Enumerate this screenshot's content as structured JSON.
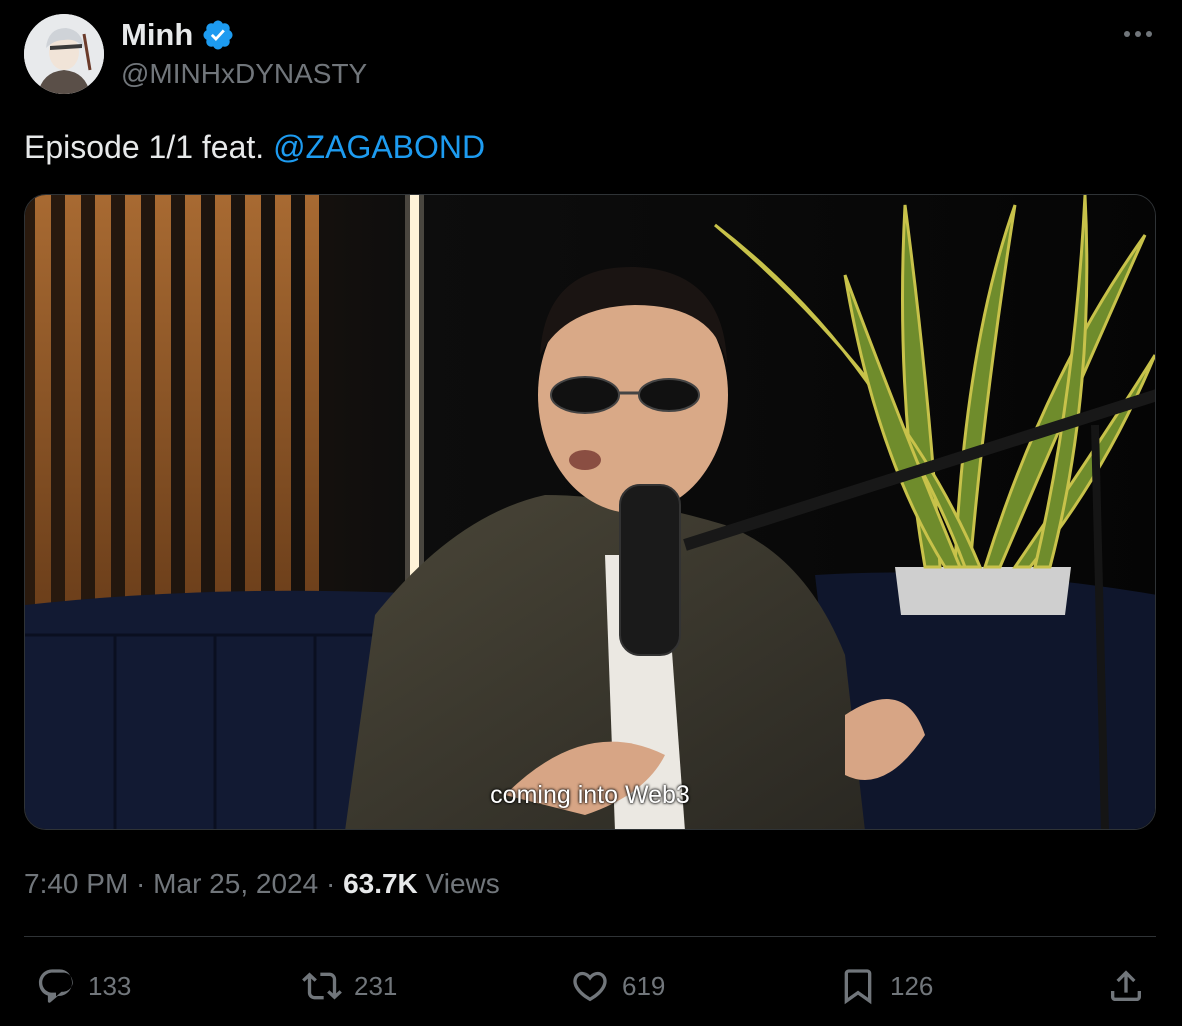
{
  "author": {
    "display_name": "Minh",
    "handle": "@MINHxDYNASTY",
    "verified": true,
    "verified_color": "#1d9bf0"
  },
  "tweet": {
    "text_prefix": "Episode 1/1 feat. ",
    "mention": "@ZAGABOND",
    "mention_color": "#1d9bf0"
  },
  "media": {
    "caption": "coming into Web3"
  },
  "meta": {
    "time": "7:40 PM",
    "separator1": " · ",
    "date": "Mar 25, 2024",
    "separator2": " · ",
    "views_count": "63.7K",
    "views_label": " Views"
  },
  "actions": {
    "replies": "133",
    "retweets": "231",
    "likes": "619",
    "bookmarks": "126"
  },
  "icons": {
    "more": "more-icon",
    "reply": "reply-icon",
    "retweet": "retweet-icon",
    "like": "heart-icon",
    "bookmark": "bookmark-icon",
    "share": "share-icon",
    "verified": "verified-badge-icon"
  }
}
